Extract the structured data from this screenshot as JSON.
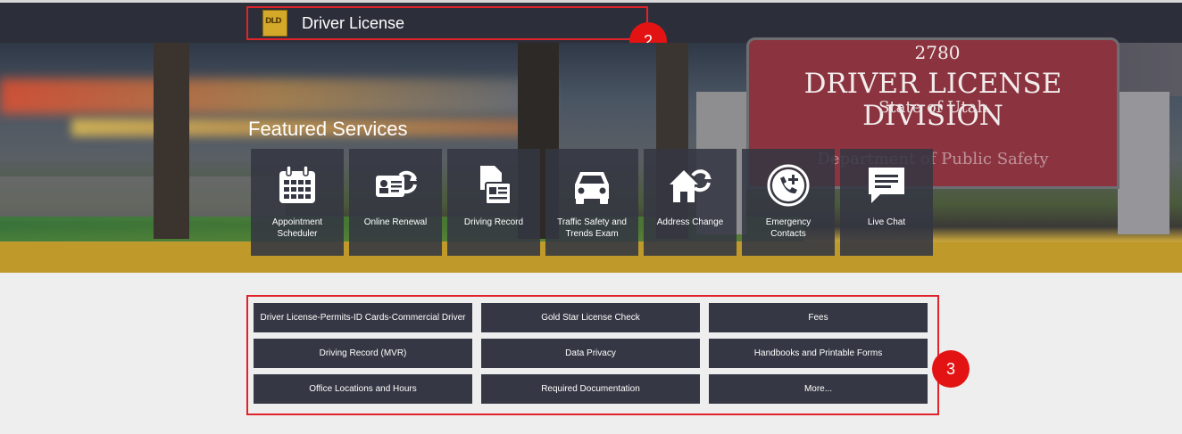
{
  "header": {
    "title": "Driver License",
    "logo_icon": "dld-logo-icon"
  },
  "markers": {
    "header": "2",
    "links": "3"
  },
  "hero": {
    "featured_heading": "Featured Services",
    "sign": {
      "number": "2780",
      "title": "DRIVER LICENSE DIVISION",
      "subtitle": "State of Utah",
      "department": "Department of Public Safety"
    },
    "services": [
      {
        "label": "Appointment Scheduler",
        "icon": "calendar-icon"
      },
      {
        "label": "Online Renewal",
        "icon": "id-card-renew-icon"
      },
      {
        "label": "Driving Record",
        "icon": "document-record-icon"
      },
      {
        "label": "Traffic Safety and Trends Exam",
        "icon": "car-icon"
      },
      {
        "label": "Address Change",
        "icon": "house-change-icon"
      },
      {
        "label": "Emergency Contacts",
        "icon": "phone-plus-icon"
      },
      {
        "label": "Live Chat",
        "icon": "chat-bubble-icon"
      }
    ]
  },
  "links": [
    "Driver License-Permits-ID Cards-Commercial Driver",
    "Gold Star License Check",
    "Fees",
    "Driving Record (MVR)",
    "Data Privacy",
    "Handbooks and Printable Forms",
    "Office Locations and Hours",
    "Required Documentation",
    "More..."
  ],
  "colors": {
    "header_bg": "#2c2f3a",
    "tile_bg": "#343742",
    "link_bg": "#353844",
    "highlight_border": "#e0232b",
    "marker": "#e31313",
    "gold_band": "#bf9a2b"
  }
}
